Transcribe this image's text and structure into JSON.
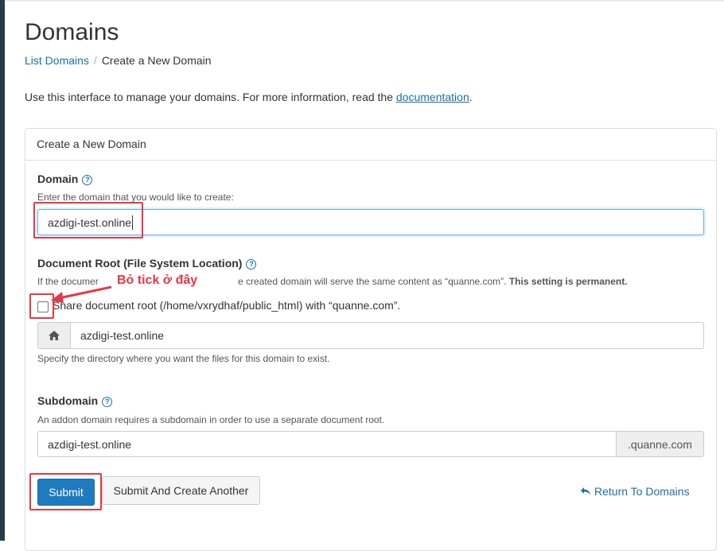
{
  "page": {
    "title": "Domains",
    "breadcrumb": {
      "link": "List Domains",
      "separator": "/",
      "current": "Create a New Domain"
    },
    "intro_prefix": "Use this interface to manage your domains. For more information, read the ",
    "intro_link": "documentation",
    "intro_suffix": "."
  },
  "panel": {
    "heading": "Create a New Domain",
    "domain": {
      "label": "Domain",
      "help": "Enter the domain that you would like to create:",
      "value": "azdigi-test.online"
    },
    "document_root": {
      "label": "Document Root (File System Location)",
      "help_start": "If the documer",
      "help_end": "e created domain will serve the same content as “quanne.com”. ",
      "help_bold": "This setting is permanent.",
      "checkbox_label": "Share document root (/home/vxrydhaf/public_html) with “quanne.com”.",
      "checked": false,
      "value": "azdigi-test.online",
      "hint": "Specify the directory where you want the files for this domain to exist."
    },
    "subdomain": {
      "label": "Subdomain",
      "help": "An addon domain requires a subdomain in order to use a separate document root.",
      "value": "azdigi-test.online",
      "suffix": ".quanne.com"
    },
    "buttons": {
      "submit": "Submit",
      "submit_another": "Submit And Create Another",
      "return": "Return To Domains"
    }
  },
  "annotation": {
    "text": "Bỏ tick ở đây",
    "color": "#e53846"
  },
  "colors": {
    "primary": "#1f7bc0",
    "link": "#1a6ea8",
    "sidebar": "#293a4a"
  },
  "icons": {
    "help": "question-circle-icon",
    "home": "home-icon",
    "return": "reply-arrow-icon"
  }
}
